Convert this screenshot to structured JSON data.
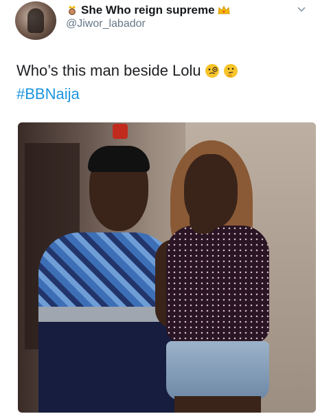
{
  "header": {
    "display_name": "She Who reign supreme",
    "handle": "@Jiwor_labador",
    "icons": [
      "woman-with-crown-emoji-icon",
      "crown-emoji-icon",
      "chevron-down-icon"
    ]
  },
  "tweet": {
    "text": "Who’s this man beside Lolu",
    "text_emojis": [
      "face-with-monocle-emoji-icon",
      "thinking-face-emoji-icon"
    ],
    "hashtag": "#BBNaija"
  },
  "colors": {
    "text": "#1c1e21",
    "handle": "#657786",
    "link": "#1b95e0",
    "background": "#ffffff"
  }
}
